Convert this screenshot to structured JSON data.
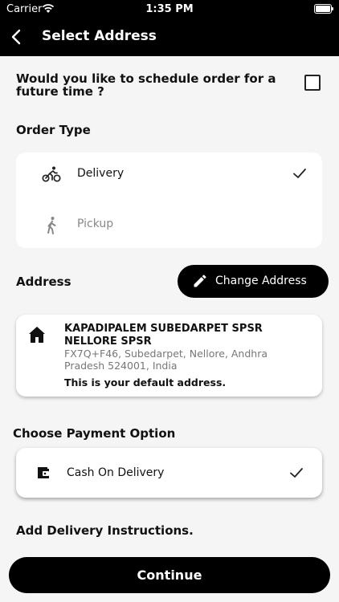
{
  "status_bar": {
    "carrier": "Carrier",
    "time": "1:35 PM"
  },
  "nav": {
    "title": "Select Address"
  },
  "schedule": {
    "question": "Would you like to schedule order for a future time ?",
    "checked": false
  },
  "order_type": {
    "heading": "Order Type",
    "options": [
      {
        "label": "Delivery",
        "selected": true,
        "icon": "bicycle-icon"
      },
      {
        "label": "Pickup",
        "selected": false,
        "icon": "walking-person-icon"
      }
    ]
  },
  "address": {
    "heading": "Address",
    "change_label": "Change Address",
    "name": "KAPADIPALEM SUBEDARPET SPSR NELLORE SPSR",
    "detail": "FX7Q+F46, Subedarpet, Nellore, Andhra Pradesh 524001, India",
    "default_note": "This is your default address."
  },
  "payment": {
    "heading": "Choose Payment Option",
    "option": {
      "label": "Cash On Delivery",
      "selected": true,
      "icon": "wallet-icon"
    }
  },
  "instructions": {
    "heading": "Add Delivery Instructions."
  },
  "footer": {
    "continue_label": "Continue"
  },
  "colors": {
    "primary": "#000000",
    "background": "#f5f5f5",
    "card": "#ffffff",
    "muted": "#888888"
  }
}
